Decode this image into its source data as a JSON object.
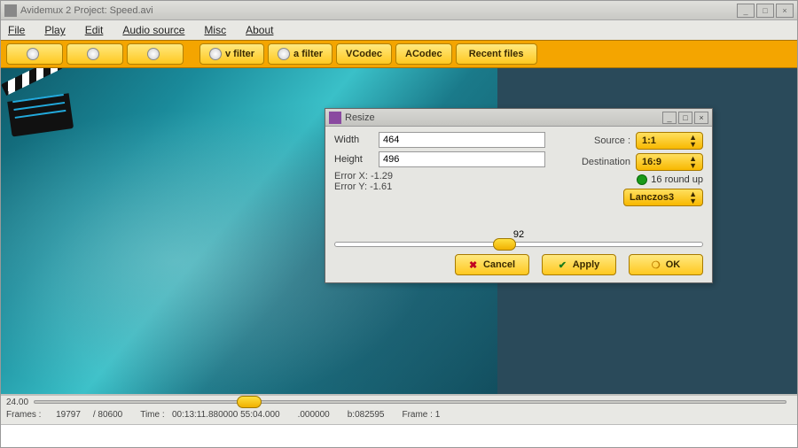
{
  "mainWindow": {
    "title": "Avidemux 2 Project: Speed.avi"
  },
  "menu": {
    "file": "File",
    "play": "Play",
    "edit": "Edit",
    "audio": "Audio source",
    "misc": "Misc",
    "about": "About"
  },
  "toolbar": {
    "open": "",
    "info": "",
    "save": "",
    "vfilter": "v filter",
    "afilter": "a filter",
    "vcodec": "VCodec",
    "acodec": "ACodec",
    "recent": "Recent files"
  },
  "dialog": {
    "title": "Resize",
    "widthLabel": "Width",
    "widthValue": "464",
    "heightLabel": "Height",
    "heightValue": "496",
    "errX": "Error X: -1.29",
    "errY": "Error Y: -1.61",
    "srcLabel": "Source :",
    "dstLabel": "Destination",
    "srcAspect": "1:1",
    "dstAspect": "16:9",
    "roundLabel": "16 round up",
    "methodLabel": "Lanczos3",
    "sliderVal": "92",
    "cancel": "Cancel",
    "apply": "Apply",
    "ok": "OK"
  },
  "status": {
    "posLeft": "24.00",
    "frames": "Frames :",
    "frameCur": "19797",
    "frameSep": "/",
    "frameTot": "80600",
    "timeLbl": "Time :",
    "time": "00:13:11.880000 55:04.000",
    "rate": ".000000",
    "bitrate": "b:082595",
    "frameIdx": "Frame : 1"
  },
  "sliders": {
    "mainKnobLeft": 228,
    "dlgKnobLeft": 178
  }
}
